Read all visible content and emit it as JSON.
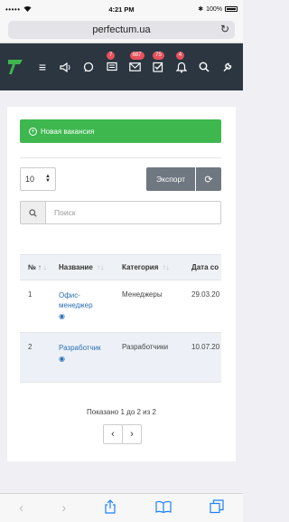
{
  "status_bar": {
    "carrier_dots": "•••••",
    "time": "4:21 PM",
    "battery": "100%"
  },
  "browser": {
    "url": "perfectum.ua"
  },
  "header": {
    "badges": {
      "chat": "7",
      "mail": "687",
      "tasks": "75",
      "notifications": "4"
    }
  },
  "actions": {
    "new_vacancy": "Новая вакансия",
    "export": "Экспорт"
  },
  "pager": {
    "page_size": "10"
  },
  "search": {
    "placeholder": "Поиск"
  },
  "table": {
    "headers": [
      "№",
      "Название",
      "Категория",
      "Дата со"
    ],
    "rows": [
      {
        "num": "1",
        "name_line1": "Офис-",
        "name_line2": "менеджер",
        "category": "Менеджеры",
        "date": "29.03.20"
      },
      {
        "num": "2",
        "name_line1": "Разработчик",
        "name_line2": "",
        "category": "Разработчики",
        "date": "10.07.20"
      }
    ]
  },
  "pagination": {
    "summary": "Показано 1 до 2 из 2"
  },
  "colors": {
    "header_bg": "#2c3640",
    "accent_green": "#3eb74f",
    "badge_red": "#e8505b",
    "link_blue": "#2a6fb6",
    "ios_blue": "#1a82fb"
  }
}
